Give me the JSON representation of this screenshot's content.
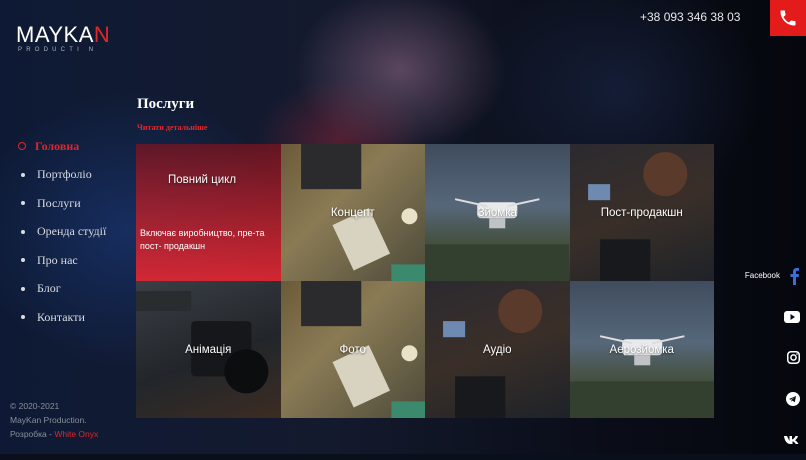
{
  "brand": {
    "logo_main_pre": "MAYKA",
    "logo_main_post": "N",
    "logo_sub": "PRODUCTI N"
  },
  "header": {
    "phone": "+38 093 346 38 03",
    "call_icon": "phone-icon"
  },
  "nav": [
    {
      "label": "Головна",
      "active": true
    },
    {
      "label": "Портфоліо"
    },
    {
      "label": "Послуги"
    },
    {
      "label": "Оренда студії"
    },
    {
      "label": "Про нас"
    },
    {
      "label": "Блог"
    },
    {
      "label": "Контакти"
    }
  ],
  "main": {
    "title": "Послуги",
    "read_more": "Читати детальніше"
  },
  "services": [
    {
      "label": "Повний цикл",
      "desc": "Включає виробництво, пре-та пост- продакшн",
      "style": "cam"
    },
    {
      "label": "Концепт",
      "style": "desk"
    },
    {
      "label": "Зйомка",
      "style": "drone"
    },
    {
      "label": "Пост-продакшн",
      "style": "edit"
    },
    {
      "label": "Анімація",
      "style": "cam"
    },
    {
      "label": "Фото",
      "style": "desk"
    },
    {
      "label": "Аудіо",
      "style": "edit"
    },
    {
      "label": "Аерозйомка",
      "style": "drone"
    }
  ],
  "social": {
    "facebook_label": "Facebook",
    "icons": [
      "facebook-icon",
      "youtube-icon",
      "instagram-icon",
      "telegram-icon",
      "vk-icon"
    ]
  },
  "footer": {
    "years": "© 2020-2021",
    "company": "MayKan Production.",
    "dev_prefix": "Розробка - ",
    "dev_name": "White Onyx"
  },
  "colors": {
    "accent": "#e31b1b",
    "background": "#0a0f1c"
  }
}
